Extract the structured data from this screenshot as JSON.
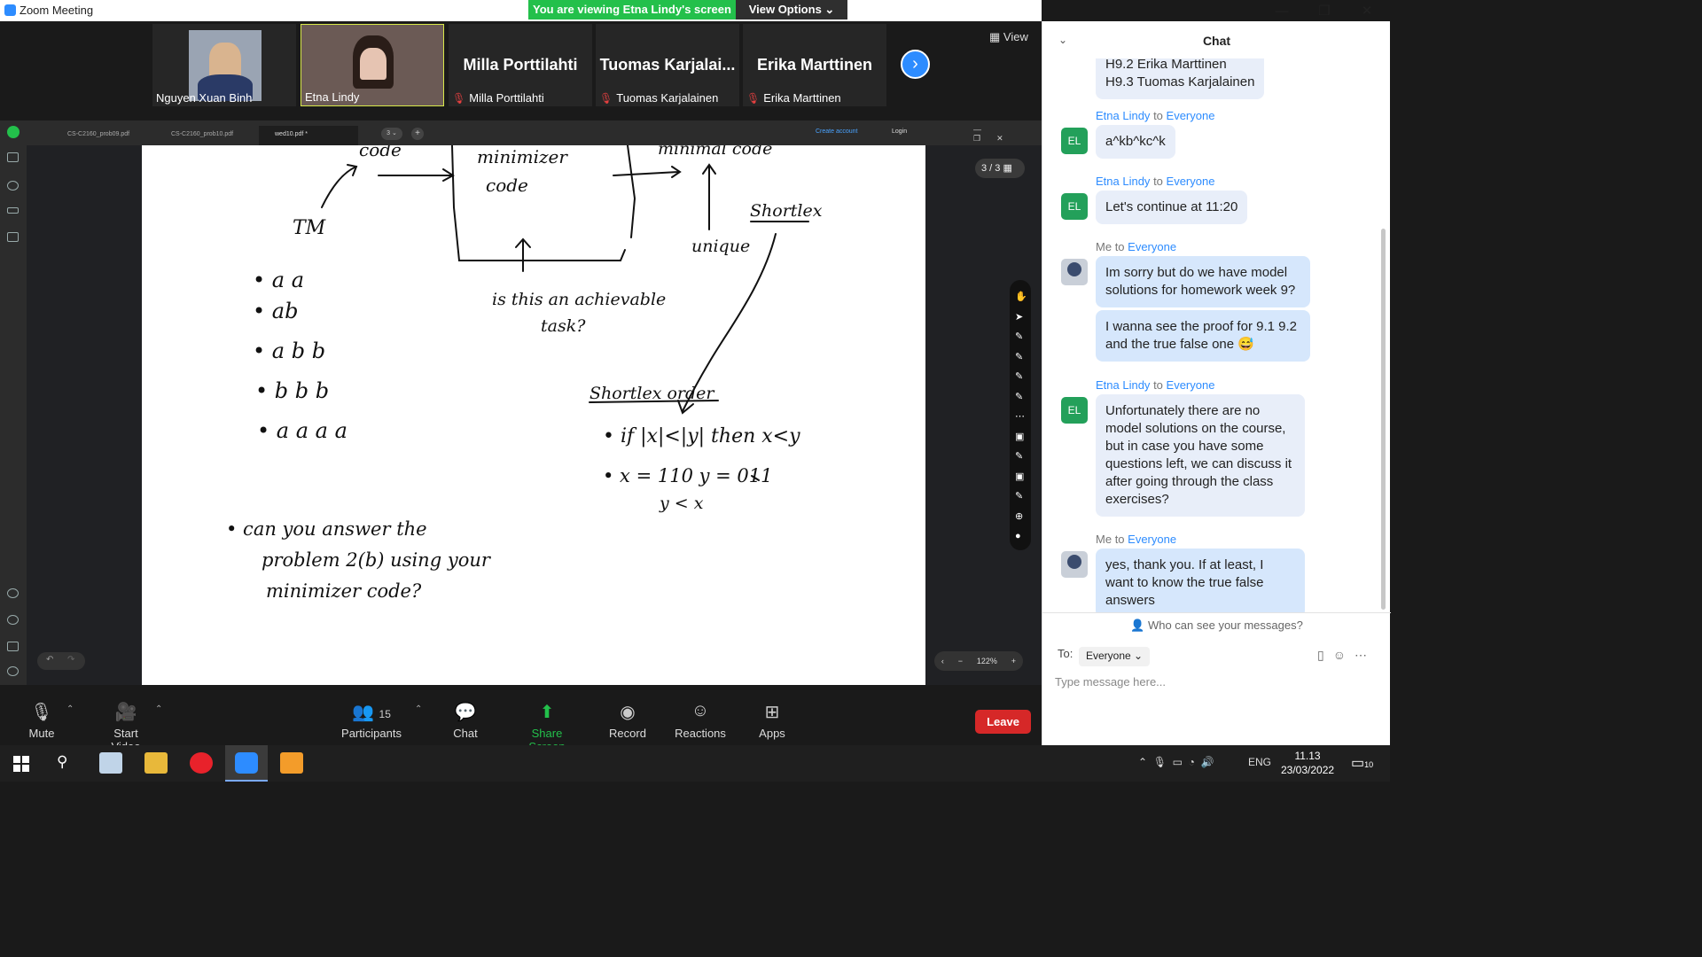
{
  "window": {
    "title": "Zoom Meeting",
    "minimize": "—",
    "maximize": "❐",
    "close": "✕"
  },
  "banner": {
    "viewing": "You are viewing Etna Lindy's screen",
    "view_options": "View Options ⌄"
  },
  "gallery": {
    "view_label": "▦ View",
    "participants": [
      {
        "name": "Nguyen Xuan Binh",
        "big": ""
      },
      {
        "name": "Etna Lindy",
        "big": ""
      },
      {
        "name": "Milla Porttilahti",
        "big": "Milla Porttilahti"
      },
      {
        "name": "Tuomas Karjalainen",
        "big": "Tuomas  Karjalai..."
      },
      {
        "name": "Erika Marttinen",
        "big": "Erika Marttinen"
      }
    ],
    "next": "›"
  },
  "pdf": {
    "tabs": [
      "CS-C2160_prob09.pdf",
      "CS-C2160_prob10.pdf",
      "wed10.pdf *"
    ],
    "tab_count": "3 ⌄",
    "create_account": "Create account",
    "login": "Login",
    "page_indicator": "3 / 3",
    "zoom": "122%",
    "zoom_minus": "−",
    "zoom_plus": "+",
    "prev": "‹"
  },
  "whiteboard": {
    "code": "code",
    "minimizer_code": "minimizer code",
    "minimal_code": "minimal code",
    "tm": "TM",
    "shortlex": "Shortlex",
    "unique": "unique",
    "question": "is this an achievable task?",
    "list": [
      "a a",
      "ab",
      "a b b",
      "b b b",
      "a a a a"
    ],
    "shortlex_order": "Shortlex order",
    "rule1": "if |x| < |y| then x < y",
    "rule2": "x = 110   y = 011",
    "rule3": "y < x",
    "prompt": "can you answer the problem 2(b) using your minimizer code?"
  },
  "toolbar": {
    "mute": "Mute",
    "start_video": "Start Video",
    "participants": "Participants",
    "participant_count": "15",
    "chat": "Chat",
    "share_screen": "Share Screen",
    "record": "Record",
    "reactions": "Reactions",
    "apps": "Apps",
    "leave": "Leave"
  },
  "chat": {
    "title": "Chat",
    "partial_top": "H9.2 Erika Marttinen",
    "partial_line": "H9.3 Tuomas Karjalainen",
    "messages": [
      {
        "from": "Etna Lindy",
        "to": "to",
        "target": "Everyone",
        "avatar": "EL",
        "text": "a^kb^kc^k"
      },
      {
        "from": "Etna Lindy",
        "to": "to",
        "target": "Everyone",
        "avatar": "EL",
        "text": "Let's continue at 11:20"
      },
      {
        "from": "Me",
        "to": "to",
        "target": "Everyone",
        "avatar": "",
        "text": "Im sorry but do we have model solutions for homework week 9?",
        "text2": "I wanna see the proof for 9.1 9.2 and the true false one 😅"
      },
      {
        "from": "Etna Lindy",
        "to": "to",
        "target": "Everyone",
        "avatar": "EL",
        "text": "Unfortunately there are no model solutions on the course, but in case you have some questions left, we can discuss it after going through the class exercises?"
      },
      {
        "from": "Me",
        "to": "to",
        "target": "Everyone",
        "avatar": "",
        "text": "yes, thank you. If at least, I want to know the true false answers"
      }
    ],
    "who_can_see": "Who can see your messages?",
    "to_label": "To:",
    "to_value": "Everyone ⌄",
    "input_placeholder": "Type message here..."
  },
  "taskbar": {
    "lang": "ENG",
    "time": "11.13",
    "date": "23/03/2022",
    "notifications": "10"
  }
}
